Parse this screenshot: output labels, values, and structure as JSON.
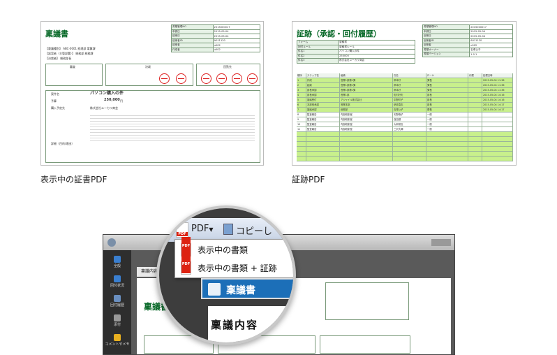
{
  "captions": {
    "left": "表示中の証書PDF",
    "right": "証跡PDF"
  },
  "left_doc": {
    "title": "稟議書",
    "info_rows": [
      {
        "k": "書類管理NO",
        "v": "2015000017"
      },
      {
        "k": "申請日",
        "v": "2015-05-04"
      },
      {
        "k": "起案日",
        "v": "2015-05-04"
      },
      {
        "k": "起案者ID",
        "v": "A011120"
      },
      {
        "k": "起案者",
        "v": "u002"
      },
      {
        "k": "作成者",
        "v": "u002"
      }
    ],
    "meta_lines": [
      "【稟議種別】 ABC-0001 経理部 電算課",
      "【起案者（主管部署）】 総務部 総務課",
      "【決裁者】 総務部長"
    ],
    "sections": {
      "review": "審査",
      "approval": "決裁",
      "circulation": "回覧先"
    },
    "subject_label": "案件名",
    "subject_value": "パソコン購入の件",
    "amount_label": "予算",
    "amount_value": "250,000",
    "amount_unit": "円",
    "vendor_label": "購入予定先",
    "vendor_value": "株式会社ユーカリ商会",
    "detail_label": "詳細（目的/理由）"
  },
  "right_doc": {
    "title": "証跡（承認・回付履歴）",
    "info_rows": [
      {
        "k": "フォーム",
        "v": "稟議書"
      },
      {
        "k": "回付ルール",
        "v": "稟議書ルール"
      },
      {
        "k": "件名1",
        "v": "パソコン購入の件"
      },
      {
        "k": "件名2",
        "v": "250000"
      },
      {
        "k": "件名3",
        "v": "株式会社ユーカリ商会"
      }
    ],
    "info_right": [
      {
        "k": "書類管理NO",
        "v": "2015000017"
      },
      {
        "k": "申請日",
        "v": "2015-05-04"
      },
      {
        "k": "起案日",
        "v": "2015-05-04"
      },
      {
        "k": "起案者ID",
        "v": "A011120"
      },
      {
        "k": "起案者",
        "v": "u002"
      },
      {
        "k": "書類オーナー",
        "v": "石塚公子"
      },
      {
        "k": "書類バージョン",
        "v": "1.0.1"
      }
    ],
    "columns": [
      "順序",
      "ステップ名",
      "組織",
      "氏名",
      "ロール",
      "代理",
      "処理日時"
    ],
    "rows": [
      [
        "1",
        "作成",
        "営業1部第1課",
        "岸本好",
        "課長",
        "",
        "2015-05-04 11:36"
      ],
      [
        "2",
        "起案",
        "営業1部第1課",
        "岸本好",
        "課長",
        "",
        "2015-05-04 11:36"
      ],
      [
        "3",
        "部長承認",
        "営業1部第1課",
        "岸本好",
        "課長",
        "",
        "2015-05-04 11:36"
      ],
      [
        "4",
        "部長承認",
        "営業1部",
        "佐村好夫",
        "部長",
        "",
        "2015-05-04 14:16"
      ],
      [
        "5",
        "稟議受付",
        "アジャイル株式会社",
        "中野町子",
        "部長",
        "",
        "2015-05-04 14:16"
      ],
      [
        "6",
        "本部長承認",
        "営業本部",
        "伊佐直志",
        "部長",
        "",
        "2015-05-04 14:17"
      ],
      [
        "7",
        "稟議承認",
        "総務部",
        "石塚公子",
        "課長",
        "",
        "2015-05-04 14:17"
      ],
      [
        "8",
        "監査報告",
        "内部統制室",
        "矢野峰子",
        "一般",
        "",
        ""
      ],
      [
        "9",
        "監査報告",
        "内部統制室",
        "西田健",
        "一般",
        "",
        ""
      ],
      [
        "10",
        "監査報告",
        "内部統制室",
        "大和常世",
        "一般",
        "",
        ""
      ],
      [
        "11",
        "監査報告",
        "内部統制室",
        "三沢大輝",
        "一般",
        "",
        ""
      ]
    ]
  },
  "app": {
    "sidebar": [
      {
        "label": "全般",
        "icon": "document-icon"
      },
      {
        "label": "回付状況",
        "icon": "flow-icon"
      },
      {
        "label": "回付履歴",
        "icon": "history-icon"
      },
      {
        "label": "添付",
        "icon": "attachment-icon"
      },
      {
        "label": "コメントやメモ",
        "icon": "comment-icon"
      }
    ],
    "doc_title": "稟議書",
    "tab_label": "稟議内容",
    "toolbar_pdf": "PDF",
    "toolbar_copy": "コピーし",
    "menu": {
      "item1": "表示中の書類",
      "item2": "表示中の書類 + 証跡"
    },
    "card_label": "稟議書",
    "page_title": "稟議内容"
  }
}
